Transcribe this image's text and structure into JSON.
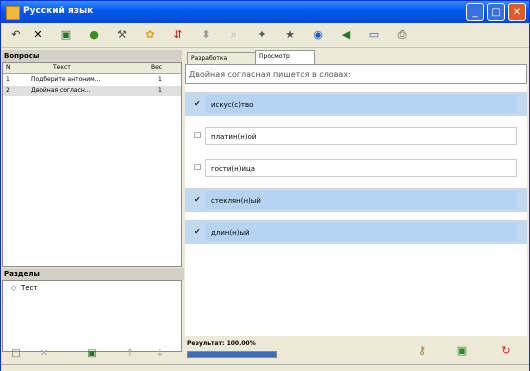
{
  "window": {
    "title": "Русский язык"
  },
  "toolbar": {
    "icons": [
      "undo-icon",
      "delete-icon",
      "save-icon",
      "refresh-icon",
      "tools-icon",
      "flower-icon",
      "sort-icon",
      "lock-icon",
      "help-icon",
      "star-icon",
      "home-icon",
      "web-icon",
      "back-icon",
      "print-icon"
    ]
  },
  "left": {
    "questions_title": "Вопросы",
    "columns": [
      "N",
      "Текст",
      "Вес"
    ],
    "rows": [
      {
        "n": "1",
        "text": "Подберите антоним...",
        "weight": "1"
      },
      {
        "n": "2",
        "text": "Двойная согласн...",
        "weight": "1"
      }
    ],
    "sections_title": "Разделы",
    "section_item": "Тест"
  },
  "tabs": [
    "Разработка",
    "Просмотр"
  ],
  "question": "Двойная согласная пишется в словах:",
  "answers": [
    {
      "text": "искус(с)тво",
      "checked": true
    },
    {
      "text": "платин(н)ой",
      "checked": false
    },
    {
      "text": "гости(н)ица",
      "checked": false
    },
    {
      "text": "стеклян(н)ый",
      "checked": true
    },
    {
      "text": "длин(н)ый",
      "checked": true
    }
  ],
  "result": {
    "label": "Результат:",
    "value": "100.00%",
    "progress": 1.0
  }
}
